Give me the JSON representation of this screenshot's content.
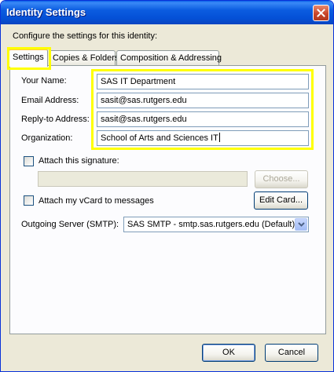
{
  "window": {
    "title": "Identity Settings",
    "close_icon": "close-icon"
  },
  "intro": "Configure the settings for this identity:",
  "tabs": [
    {
      "label": "Settings",
      "active": true
    },
    {
      "label": "Copies & Folders",
      "active": false
    },
    {
      "label": "Composition & Addressing",
      "active": false
    }
  ],
  "fields": {
    "your_name": {
      "label": "Your Name:",
      "value": "SAS IT Department"
    },
    "email": {
      "label": "Email Address:",
      "value": "sasit@sas.rutgers.edu"
    },
    "reply_to": {
      "label": "Reply-to Address:",
      "value": "sasit@sas.rutgers.edu"
    },
    "organization": {
      "label": "Organization:",
      "value": "School of Arts and Sciences IT"
    }
  },
  "signature": {
    "checkbox_label": "Attach this signature:",
    "checked": false,
    "path_value": "",
    "choose_label": "Choose..."
  },
  "vcard": {
    "checkbox_label": "Attach my vCard to messages",
    "checked": false,
    "edit_label": "Edit Card..."
  },
  "outgoing": {
    "label": "Outgoing Server (SMTP):",
    "selected": "SAS SMTP - smtp.sas.rutgers.edu (Default)"
  },
  "buttons": {
    "ok": "OK",
    "cancel": "Cancel"
  },
  "colors": {
    "highlight": "#ffff00",
    "titlebar": "#0a5fe8",
    "dialog_bg": "#ece9d8"
  }
}
